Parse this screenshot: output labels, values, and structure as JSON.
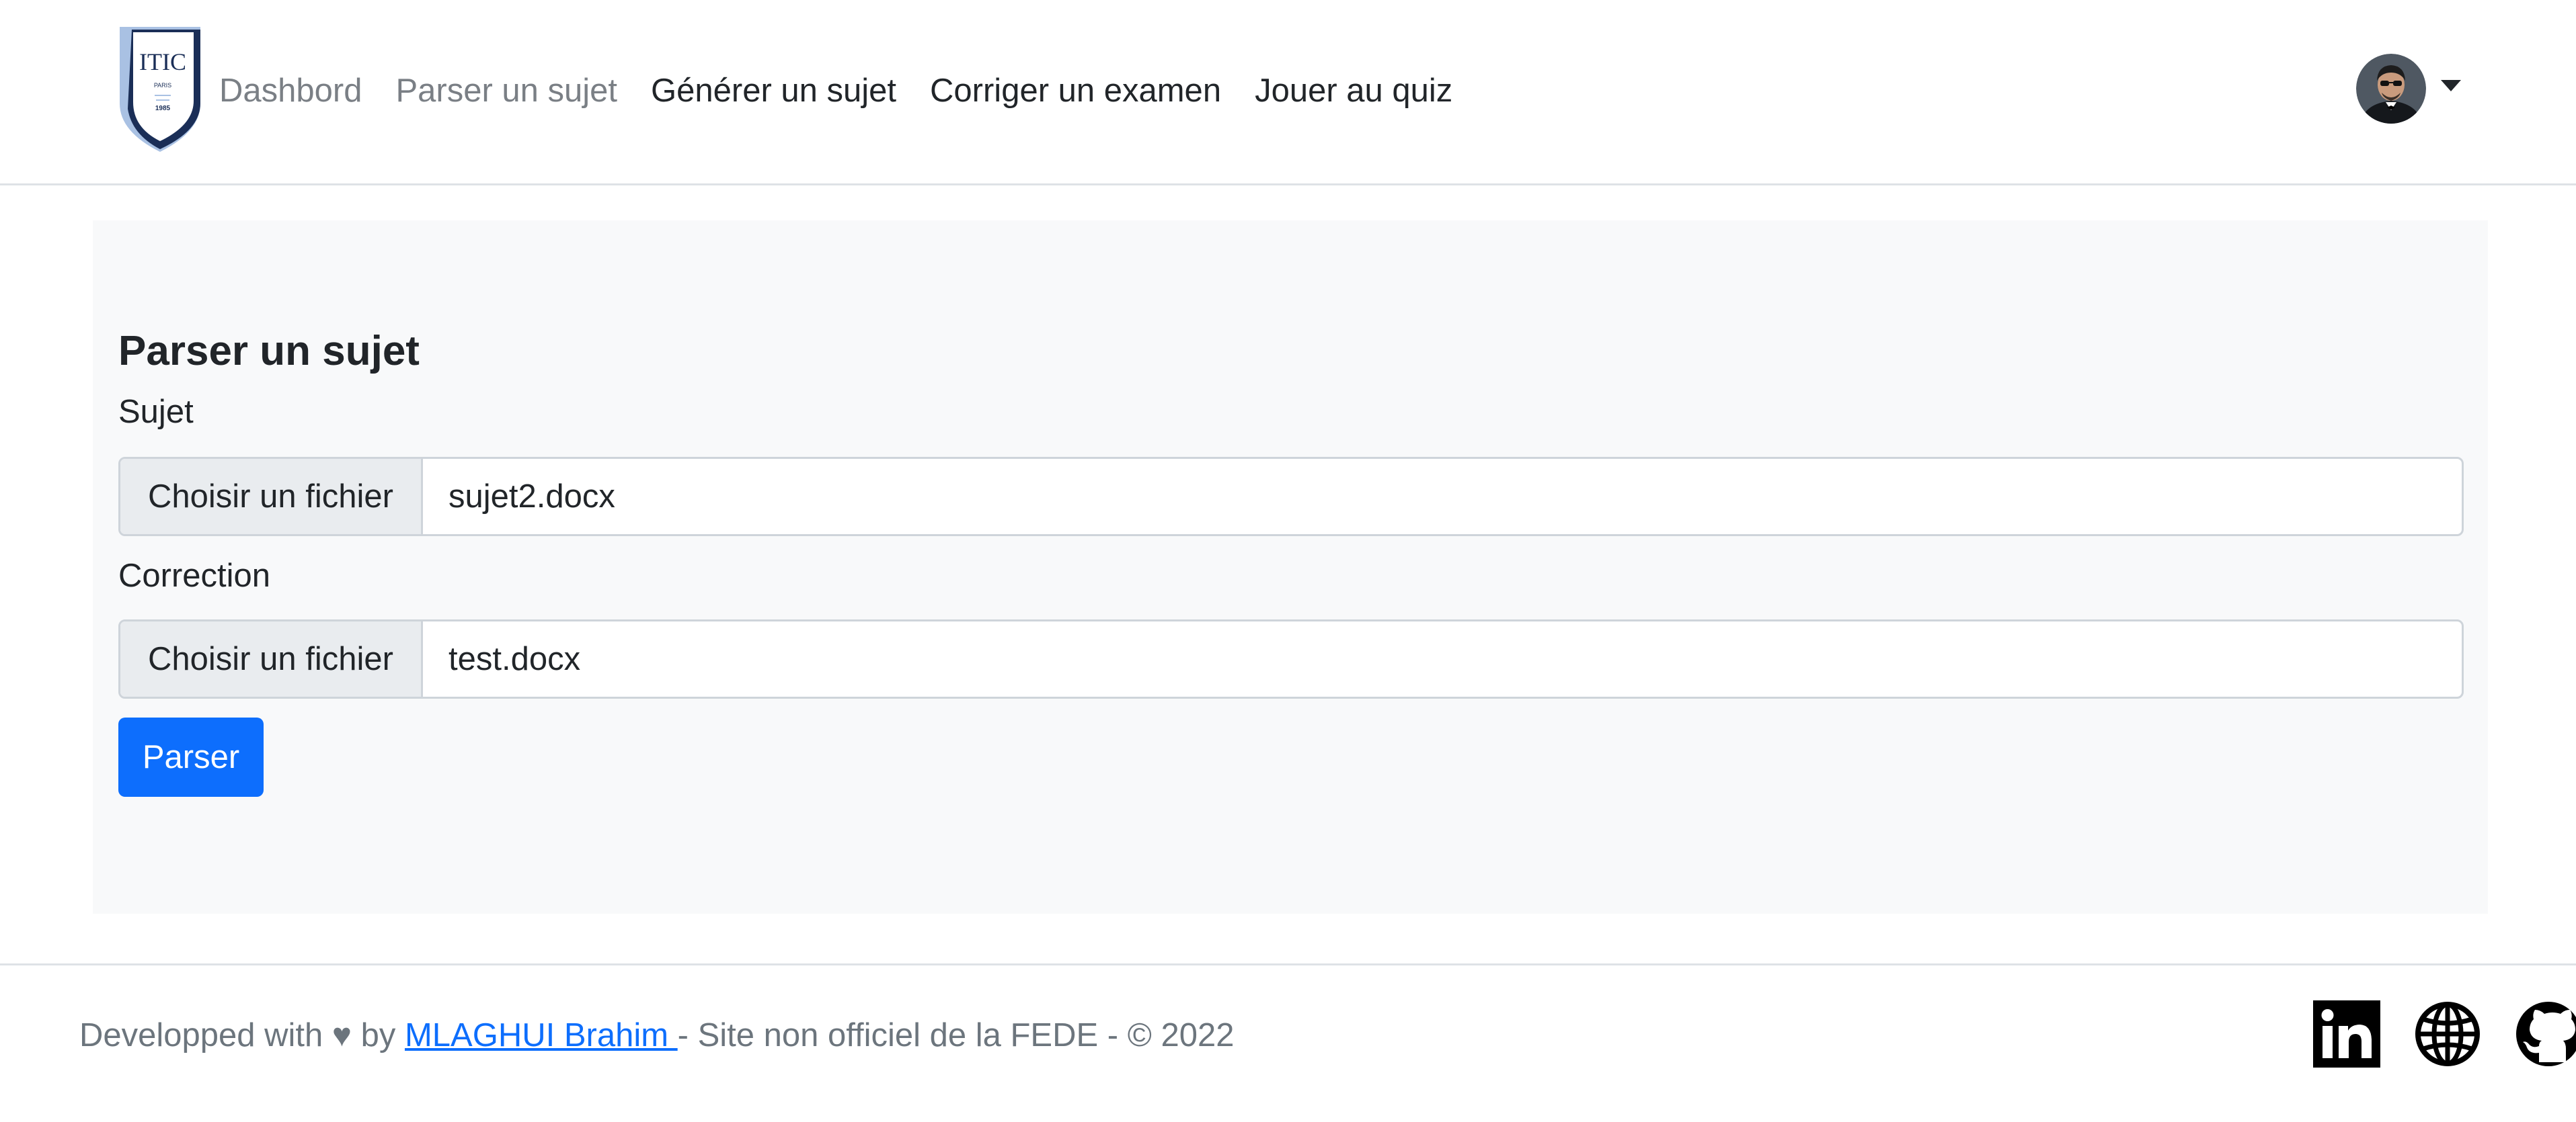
{
  "navbar": {
    "logo": {
      "text": "ITIC",
      "city": "PARIS",
      "year": "1985"
    },
    "links": [
      {
        "label": "Dashbord"
      },
      {
        "label": "Parser un sujet"
      },
      {
        "label": "Générer un sujet"
      },
      {
        "label": "Corriger un examen"
      },
      {
        "label": "Jouer au quiz"
      }
    ],
    "user_menu": {
      "icon": "avatar-dropdown"
    }
  },
  "main": {
    "title": "Parser un sujet",
    "fields": [
      {
        "label": "Sujet",
        "button_label": "Choisir un fichier",
        "file_name": "sujet2.docx"
      },
      {
        "label": "Correction",
        "button_label": "Choisir un fichier",
        "file_name": "test.docx"
      }
    ],
    "submit_label": "Parser"
  },
  "footer": {
    "prefix": "Developped with ♥ by ",
    "author": "MLAGHUI Brahim ",
    "suffix": "- Site non officiel de la FEDE - © 2022",
    "icons": [
      "linkedin-icon",
      "globe-icon",
      "github-icon"
    ]
  },
  "colors": {
    "primary": "#0d6efd",
    "panel_bg": "#f8f9fa",
    "logo_navy": "#1a2e57",
    "logo_light": "#a9c1e3"
  }
}
